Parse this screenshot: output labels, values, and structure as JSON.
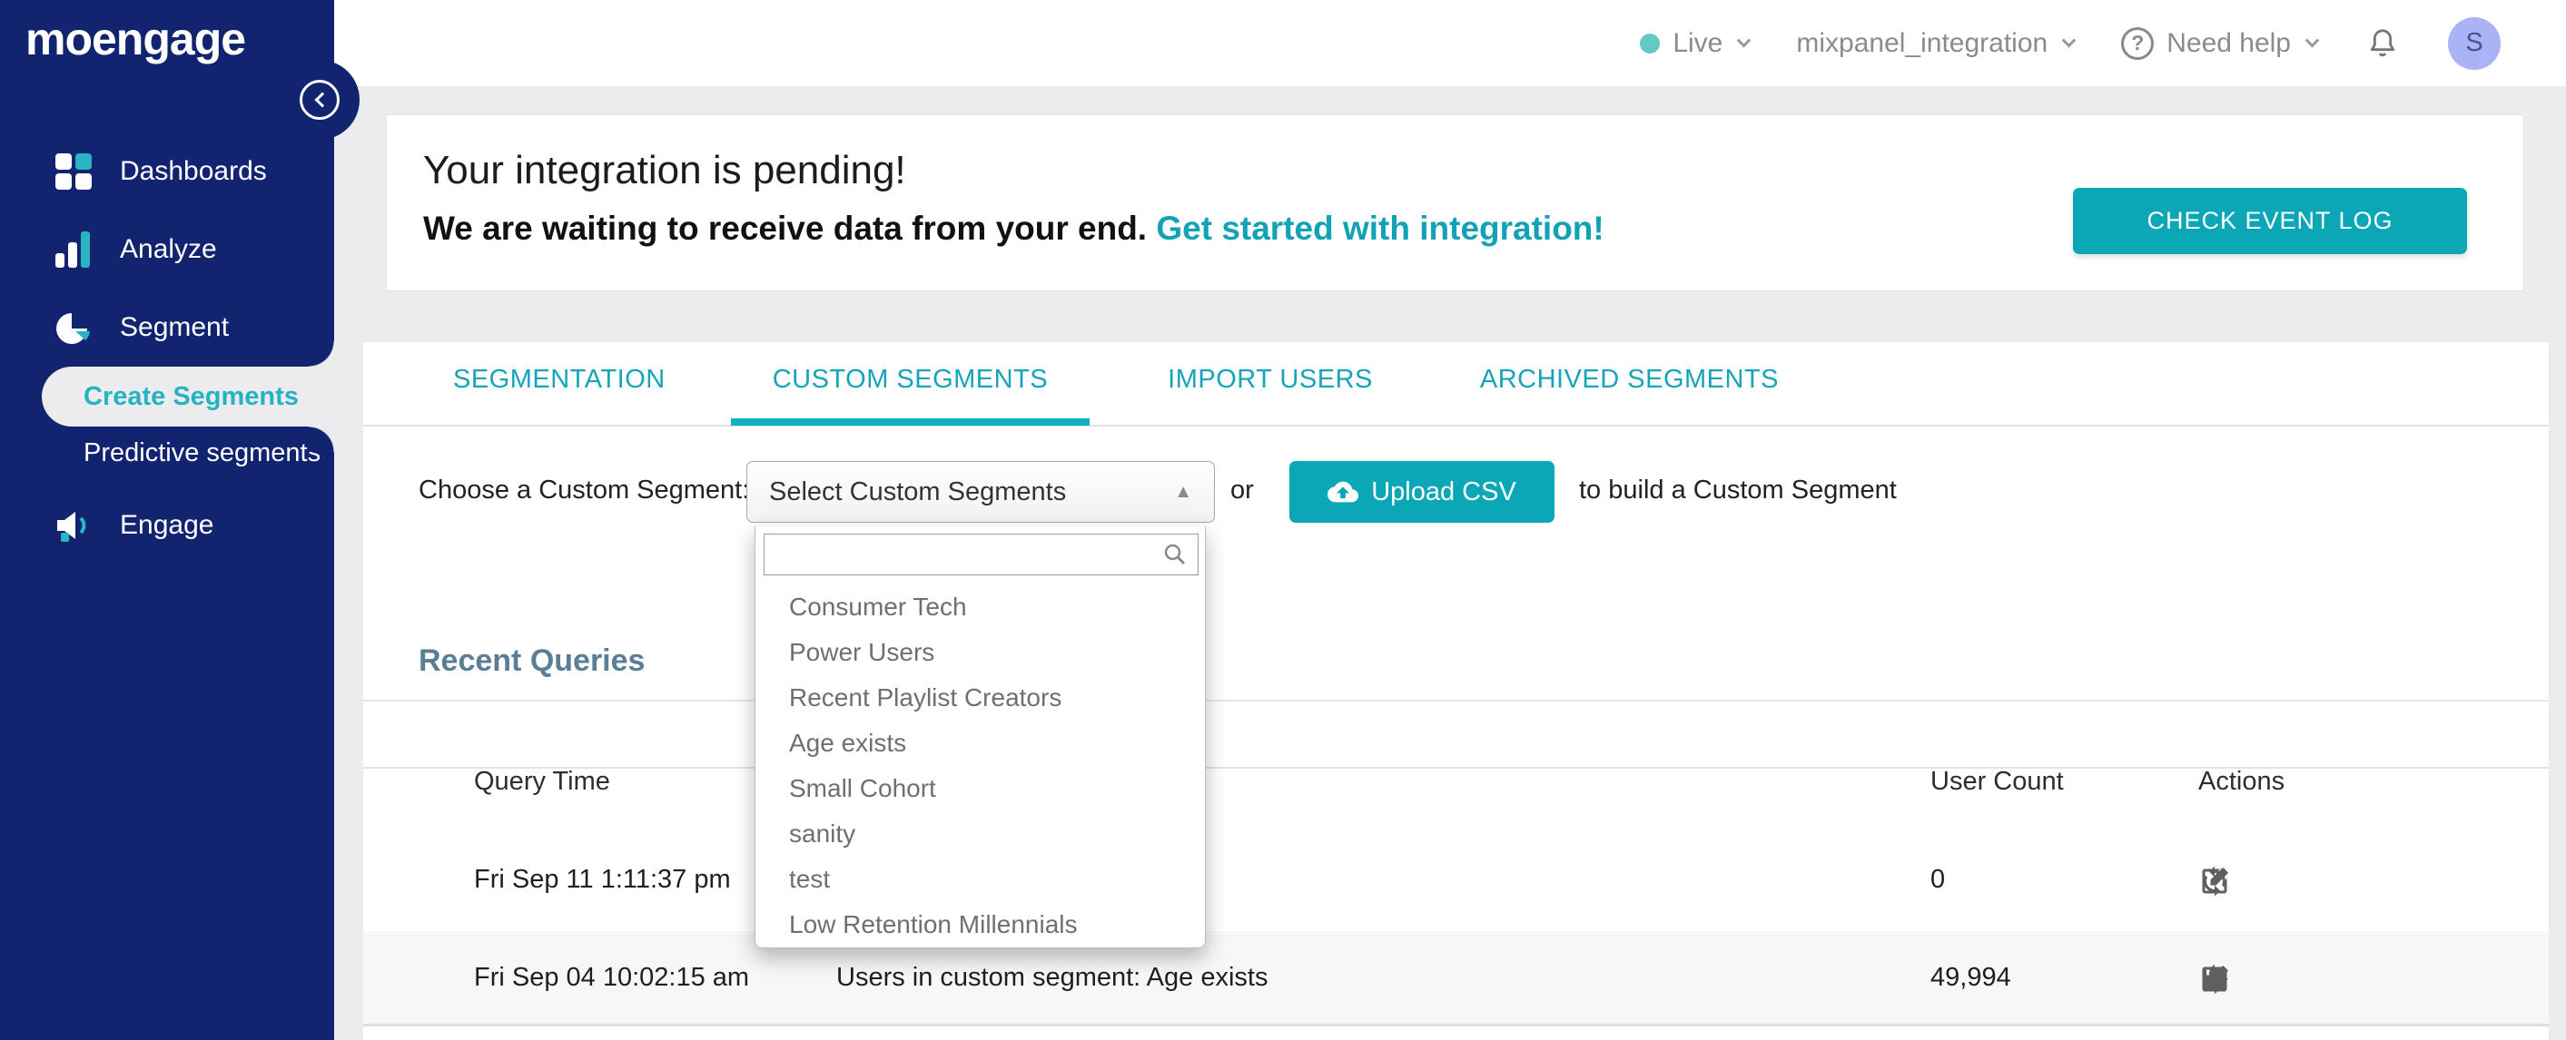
{
  "brand": {
    "logo": "moengage"
  },
  "sidebar": {
    "items": [
      {
        "label": "Dashboards",
        "icon": "dashboards-icon",
        "type": "top",
        "active": false
      },
      {
        "label": "Analyze",
        "icon": "analyze-icon",
        "type": "top",
        "active": false
      },
      {
        "label": "Segment",
        "icon": "segment-icon",
        "type": "top",
        "active": false
      },
      {
        "label": "Create Segments",
        "icon": "",
        "type": "sub",
        "active": true
      },
      {
        "label": "Predictive segments",
        "icon": "",
        "type": "sub2",
        "active": false
      },
      {
        "label": "Engage",
        "icon": "engage-icon",
        "type": "top engage",
        "active": false
      }
    ]
  },
  "header": {
    "live_label": "Live",
    "project_name": "mixpanel_integration",
    "help_label": "Need help",
    "avatar_initial": "S"
  },
  "banner": {
    "title": "Your integration is pending!",
    "subtitle": "We are waiting to receive data from your end.",
    "link_text": "Get started with integration!",
    "button_label": "CHECK EVENT LOG"
  },
  "tabs": [
    {
      "label": "SEGMENTATION",
      "active": false,
      "badge": ""
    },
    {
      "label": "CUSTOM SEGMENTS",
      "active": true,
      "badge": ""
    },
    {
      "label": "IMPORT USERS",
      "active": false,
      "badge": "import-badge-icon"
    },
    {
      "label": "ARCHIVED SEGMENTS",
      "active": false,
      "badge": ""
    }
  ],
  "chooser": {
    "label": "Choose a Custom Segment:",
    "select_value": "Select Custom Segments",
    "or_text": "or",
    "upload_label": "Upload CSV",
    "suffix_text": "to build a Custom Segment",
    "search_value": ""
  },
  "dropdown_options": [
    "Consumer Tech",
    "Power Users",
    "Recent Playlist Creators",
    "Age exists",
    "Small Cohort",
    "sanity",
    "test",
    "Low Retention Millennials"
  ],
  "recent_queries": {
    "title": "Recent Queries",
    "columns": {
      "time": "Query Time",
      "count": "User Count",
      "actions": "Actions"
    },
    "rows": [
      {
        "time": "Fri Sep 11 1:11:37 pm",
        "query": "",
        "count": "0",
        "actions": [
          "refresh-icon",
          "edit-icon"
        ]
      },
      {
        "time": "Fri Sep 04 10:02:15 am",
        "query": "Users in custom segment: Age exists",
        "count": "49,994",
        "actions": [
          "refresh-icon",
          "edit-icon",
          "user-icon",
          "save-icon",
          "export-icon"
        ]
      }
    ]
  },
  "colors": {
    "navy": "#122470",
    "teal": "#0BA7B7",
    "teal_text": "#14A5B8",
    "red_badge": "#E25757",
    "live_dot": "#62CAC3",
    "avatar_bg": "#AAB3F6",
    "heading": "#5A7E95"
  }
}
